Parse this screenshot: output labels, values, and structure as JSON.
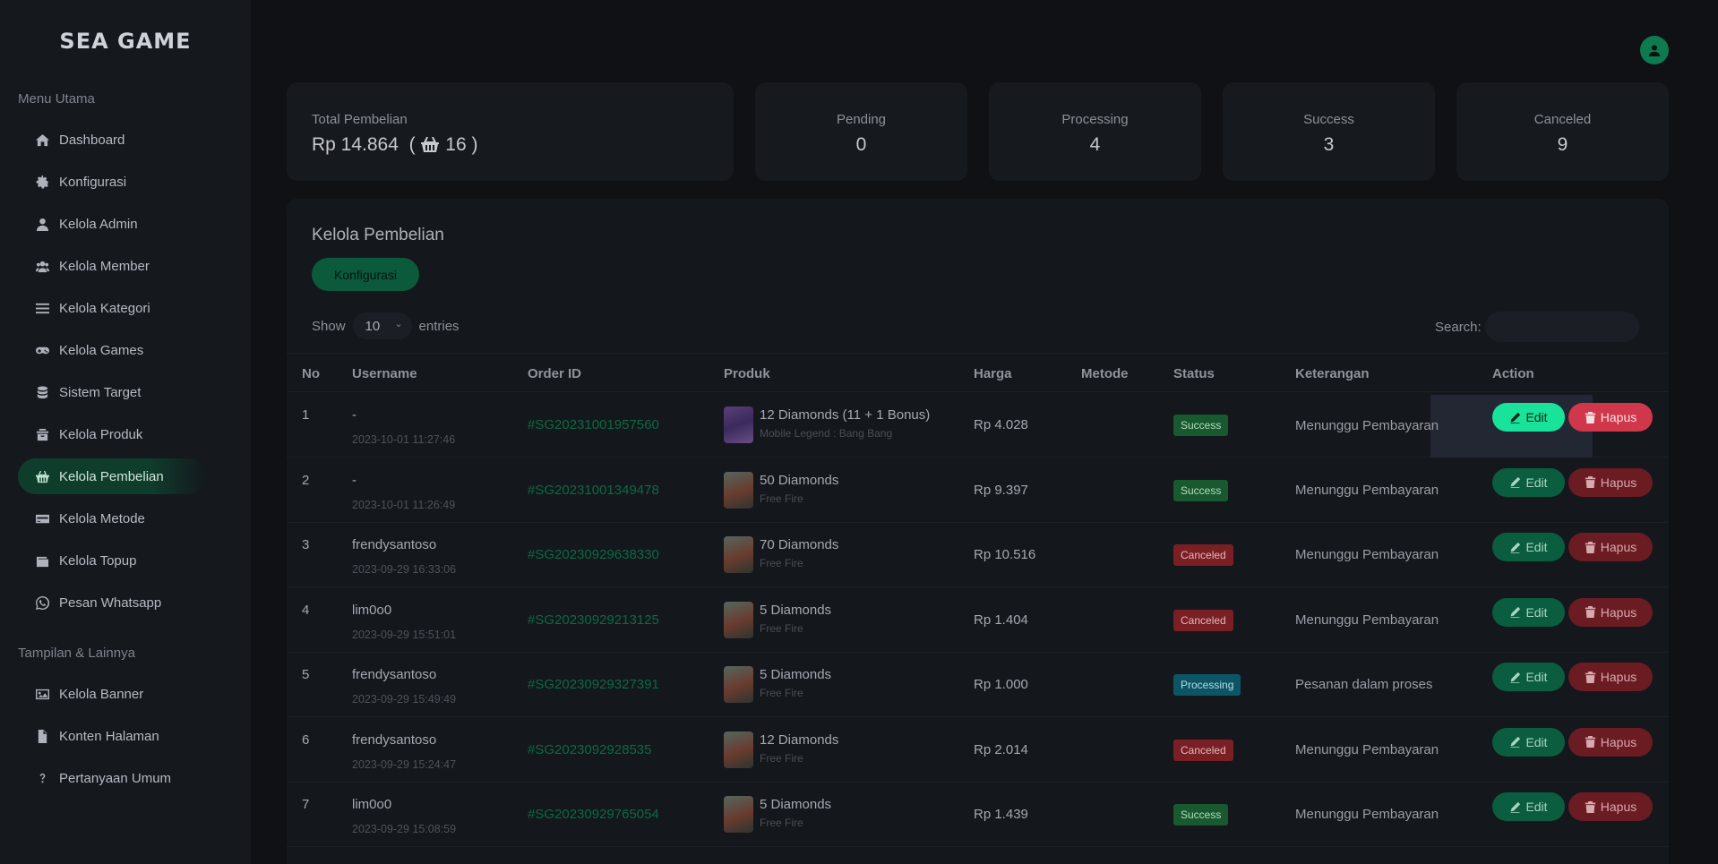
{
  "logo": "SEA GAME",
  "sidebar": {
    "section_main": "Menu Utama",
    "section_other": "Tampilan & Lainnya",
    "items": [
      {
        "label": "Dashboard",
        "icon": "home-icon"
      },
      {
        "label": "Konfigurasi",
        "icon": "gear-icon"
      },
      {
        "label": "Kelola Admin",
        "icon": "user-icon"
      },
      {
        "label": "Kelola Member",
        "icon": "users-icon"
      },
      {
        "label": "Kelola Kategori",
        "icon": "list-icon"
      },
      {
        "label": "Kelola Games",
        "icon": "gamepad-icon"
      },
      {
        "label": "Sistem Target",
        "icon": "database-icon"
      },
      {
        "label": "Kelola Produk",
        "icon": "box-icon"
      },
      {
        "label": "Kelola Pembelian",
        "icon": "basket-icon",
        "active": true
      },
      {
        "label": "Kelola Metode",
        "icon": "card-icon"
      },
      {
        "label": "Kelola Topup",
        "icon": "wallet-icon"
      },
      {
        "label": "Pesan Whatsapp",
        "icon": "whatsapp-icon"
      }
    ],
    "other_items": [
      {
        "label": "Kelola Banner",
        "icon": "image-icon"
      },
      {
        "label": "Konten Halaman",
        "icon": "file-icon"
      },
      {
        "label": "Pertanyaan Umum",
        "icon": "question-icon"
      }
    ]
  },
  "summary": {
    "total_label": "Total Pembelian",
    "total_value": "Rp 14.864",
    "total_count": "16",
    "stats": [
      {
        "label": "Pending",
        "value": "0"
      },
      {
        "label": "Processing",
        "value": "4"
      },
      {
        "label": "Success",
        "value": "3"
      },
      {
        "label": "Canceled",
        "value": "9"
      }
    ]
  },
  "table": {
    "title": "Kelola Pembelian",
    "config_button": "Konfigurasi",
    "show_label": "Show",
    "entries_value": "10",
    "entries_label": "entries",
    "search_label": "Search:",
    "columns": [
      "No",
      "Username",
      "Order ID",
      "Produk",
      "Harga",
      "Metode",
      "Status",
      "Keterangan",
      "Action"
    ],
    "edit_label": "Edit",
    "delete_label": "Hapus",
    "rows": [
      {
        "no": "1",
        "username": "-",
        "date": "2023-10-01 11:27:46",
        "order_id": "#SG20231001957560",
        "product": "12 Diamonds (11 + 1 Bonus)",
        "category": "Mobile Legend : Bang Bang",
        "price": "Rp 4.028",
        "method": "",
        "status": "Success",
        "note": "Menunggu Pembayaran"
      },
      {
        "no": "2",
        "username": "-",
        "date": "2023-10-01 11:26:49",
        "order_id": "#SG20231001349478",
        "product": "50 Diamonds",
        "category": "Free Fire",
        "price": "Rp 9.397",
        "method": "",
        "status": "Success",
        "note": "Menunggu Pembayaran"
      },
      {
        "no": "3",
        "username": "frendysantoso",
        "date": "2023-09-29 16:33:06",
        "order_id": "#SG20230929638330",
        "product": "70 Diamonds",
        "category": "Free Fire",
        "price": "Rp 10.516",
        "method": "",
        "status": "Canceled",
        "note": "Menunggu Pembayaran"
      },
      {
        "no": "4",
        "username": "lim0o0",
        "date": "2023-09-29 15:51:01",
        "order_id": "#SG20230929213125",
        "product": "5 Diamonds",
        "category": "Free Fire",
        "price": "Rp 1.404",
        "method": "",
        "status": "Canceled",
        "note": "Menunggu Pembayaran"
      },
      {
        "no": "5",
        "username": "frendysantoso",
        "date": "2023-09-29 15:49:49",
        "order_id": "#SG20230929327391",
        "product": "5 Diamonds",
        "category": "Free Fire",
        "price": "Rp 1.000",
        "method": "",
        "status": "Processing",
        "note": "Pesanan dalam proses"
      },
      {
        "no": "6",
        "username": "frendysantoso",
        "date": "2023-09-29 15:24:47",
        "order_id": "#SG2023092928535",
        "product": "12 Diamonds",
        "category": "Free Fire",
        "price": "Rp 2.014",
        "method": "",
        "status": "Canceled",
        "note": "Menunggu Pembayaran"
      },
      {
        "no": "7",
        "username": "lim0o0",
        "date": "2023-09-29 15:08:59",
        "order_id": "#SG20230929765054",
        "product": "5 Diamonds",
        "category": "Free Fire",
        "price": "Rp 1.439",
        "method": "",
        "status": "Success",
        "note": "Menunggu Pembayaran"
      }
    ]
  }
}
